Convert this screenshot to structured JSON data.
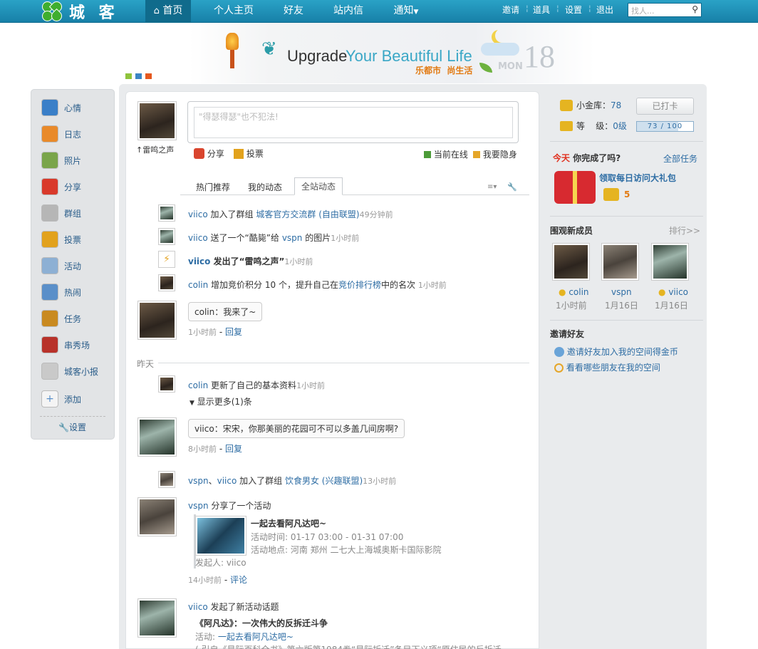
{
  "topnav": {
    "brand": "城 客",
    "home": "首页",
    "profile": "个人主页",
    "friends": "好友",
    "messages": "站内信",
    "notify": "通知",
    "invite": "邀请",
    "tools": "道具",
    "settings": "设置",
    "logout": "退出",
    "search_placeholder": "找人..."
  },
  "banner": {
    "slogan_upgrade": "Upgrade",
    "slogan_rest": "Your Beautiful Life",
    "tagline": "乐都市  尚生活",
    "weekday": "MON",
    "day": "18"
  },
  "sidebar": {
    "items": [
      {
        "label": "心情",
        "icon": "smiley-icon",
        "color": "#3a7fc8"
      },
      {
        "label": "日志",
        "icon": "notepad-icon",
        "color": "#e98a2a"
      },
      {
        "label": "照片",
        "icon": "picture-icon",
        "color": "#7aa54a"
      },
      {
        "label": "分享",
        "icon": "heart-icon",
        "color": "#d93a2b"
      },
      {
        "label": "群组",
        "icon": "group-icon",
        "color": "#b6b6b6"
      },
      {
        "label": "投票",
        "icon": "bar-chart-icon",
        "color": "#e2a21d"
      },
      {
        "label": "活动",
        "icon": "activity-icon",
        "color": "#8db0d4"
      },
      {
        "label": "热闹",
        "icon": "runner-icon",
        "color": "#5a8fc9"
      },
      {
        "label": "任务",
        "icon": "task-icon",
        "color": "#c98a20"
      },
      {
        "label": "串秀场",
        "icon": "stage-icon",
        "color": "#b8322a"
      },
      {
        "label": "城客小报",
        "icon": "newspaper-icon",
        "color": "#c9c9c9"
      },
      {
        "label": "添加",
        "icon": "plus-icon",
        "color": "#f4f4f4"
      }
    ],
    "settings": "设置"
  },
  "composer": {
    "placeholder": "\"得瑟得瑟\"也不犯法!",
    "user": "雷鸣之声",
    "share": "分享",
    "vote": "投票",
    "online": "当前在线",
    "hide": "我要隐身"
  },
  "tabs": [
    "热门推荐",
    "我的动态",
    "全站动态"
  ],
  "feed": {
    "r1": {
      "user": "viico",
      "action": "加入了群组",
      "target": "城客官方交流群 (自由联盟)",
      "time": "49分钟前"
    },
    "r2": {
      "user": "viico",
      "a1": "送了一个“酷毙”给",
      "target": "vspn",
      "a2": "的图片",
      "time": "1小时前"
    },
    "r3": {
      "user": "viico",
      "action": "发出了“雷鸣之声”",
      "time": "1小时前"
    },
    "r4": {
      "user": "colin",
      "a1": "增加竞价积分  10 个，提升自己在",
      "target": "竞价排行榜",
      "a2": "中的名次",
      "time": "1小时前"
    },
    "r5": {
      "bubble": "colin：我来了~",
      "time": "1小时前",
      "reply": "回复"
    },
    "yesterday": "昨天",
    "r6": {
      "user": "colin",
      "action": "更新了自己的基本资料",
      "time": "1小时前",
      "more": "显示更多(1)条"
    },
    "r7": {
      "bubble": "viico：宋宋，你那美丽的花园可不可以多盖几间房啊?",
      "time": "8小时前",
      "reply": "回复"
    },
    "r8": {
      "u1": "vspn",
      "sep": "、",
      "u2": "viico",
      "action": "加入了群组",
      "target": "饮食男女 (兴趣联盟)",
      "time": "13小时前"
    },
    "r9": {
      "user": "vspn",
      "action": "分享了一个活动",
      "title": "一起去看阿凡达吧~",
      "when": "活动时间: 01-17 03:00 - 01-31 07:00",
      "where": "活动地点: 河南  郑州  二七大上海城奥斯卡国际影院",
      "by": "发起人: viico",
      "time": "14小时前",
      "comment": "评论"
    },
    "r10": {
      "user": "viico",
      "action": "发起了新活动话题",
      "title": "《阿凡达》：一次伟大的反拆迁斗争",
      "act_label": "活动:",
      "act": "一起去看阿凡达吧~",
      "quote": "( 引自《星际百科全书》第六版第1984卷“星际拆迁”条目下义项“原住民的反拆迁"
    }
  },
  "right": {
    "gold_label": "小金库：",
    "gold": "78",
    "checkin": "已打卡",
    "level_label": "等    级：",
    "level": "0级",
    "progress": "73 / 100",
    "progress_value": 0.73,
    "today": "今天",
    "today_q": "你完成了吗?",
    "all_tasks": "全部任务",
    "gift": "领取每日访问大礼包",
    "gift_coins": "5",
    "new_members": "围观新成员",
    "rank": "排行>>",
    "members": [
      {
        "name": "colin",
        "time": "1小时前"
      },
      {
        "name": "vspn",
        "time": "1月16日"
      },
      {
        "name": "viico",
        "time": "1月16日"
      }
    ],
    "invite_title": "邀请好友",
    "invite1": "邀请好友加入我的空间得金币",
    "invite2": "看看哪些朋友在我的空间"
  }
}
